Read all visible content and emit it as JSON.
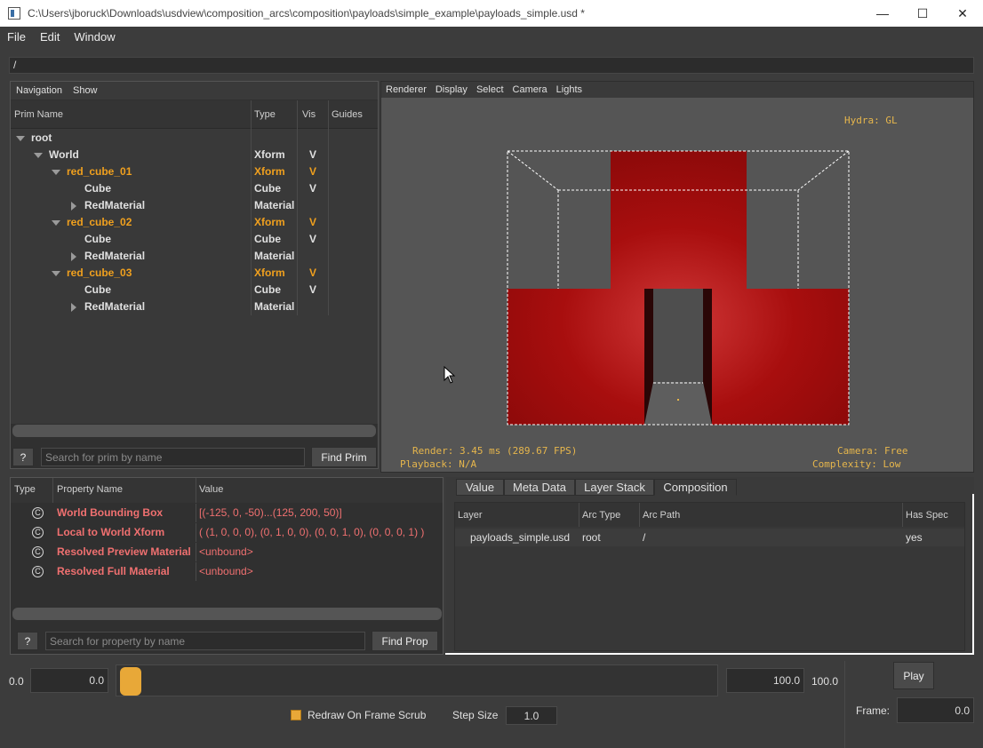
{
  "window": {
    "title": "C:\\Users\\jboruck\\Downloads\\usdview\\composition_arcs\\composition\\payloads\\simple_example\\payloads_simple.usd *",
    "minimize": "—",
    "maximize": "☐",
    "close": "✕"
  },
  "menu": [
    "File",
    "Edit",
    "Window"
  ],
  "path": "/",
  "nav": {
    "menu": [
      "Navigation",
      "Show"
    ],
    "columns": [
      "Prim Name",
      "Type",
      "Vis",
      "Guides"
    ],
    "rows": [
      {
        "name": "root",
        "type": "",
        "vis": "",
        "orange": false,
        "depth": 0,
        "arrow": "down"
      },
      {
        "name": "World",
        "type": "Xform",
        "vis": "V",
        "orange": false,
        "depth": 1,
        "arrow": "down"
      },
      {
        "name": "red_cube_01",
        "type": "Xform",
        "vis": "V",
        "orange": true,
        "depth": 2,
        "arrow": "down"
      },
      {
        "name": "Cube",
        "type": "Cube",
        "vis": "V",
        "orange": false,
        "depth": 3,
        "arrow": ""
      },
      {
        "name": "RedMaterial",
        "type": "Material",
        "vis": "",
        "orange": false,
        "depth": 3,
        "arrow": "right"
      },
      {
        "name": "red_cube_02",
        "type": "Xform",
        "vis": "V",
        "orange": true,
        "depth": 2,
        "arrow": "down"
      },
      {
        "name": "Cube",
        "type": "Cube",
        "vis": "V",
        "orange": false,
        "depth": 3,
        "arrow": ""
      },
      {
        "name": "RedMaterial",
        "type": "Material",
        "vis": "",
        "orange": false,
        "depth": 3,
        "arrow": "right"
      },
      {
        "name": "red_cube_03",
        "type": "Xform",
        "vis": "V",
        "orange": true,
        "depth": 2,
        "arrow": "down"
      },
      {
        "name": "Cube",
        "type": "Cube",
        "vis": "V",
        "orange": false,
        "depth": 3,
        "arrow": ""
      },
      {
        "name": "RedMaterial",
        "type": "Material",
        "vis": "",
        "orange": false,
        "depth": 3,
        "arrow": "right"
      }
    ],
    "help_label": "?",
    "search_placeholder": "Search for prim by name",
    "find_label": "Find Prim"
  },
  "viewport": {
    "menu": [
      "Renderer",
      "Display",
      "Select",
      "Camera",
      "Lights"
    ],
    "hud_renderer": "Hydra: GL",
    "hud_render": "Render: 3.45 ms (289.67 FPS)",
    "hud_playback": "Playback: N/A",
    "hud_camera": "Camera: Free",
    "hud_complexity": "Complexity: Low"
  },
  "props": {
    "columns": [
      "Type",
      "Property Name",
      "Value"
    ],
    "rows": [
      {
        "icon": "C",
        "name": "World Bounding Box",
        "value": "[(-125, 0, -50)...(125, 200, 50)]"
      },
      {
        "icon": "C",
        "name": "Local to World Xform",
        "value": "( (1, 0, 0, 0), (0, 1, 0, 0), (0, 0, 1, 0), (0, 0, 0, 1) )"
      },
      {
        "icon": "C",
        "name": "Resolved Preview Material",
        "value": "<unbound>"
      },
      {
        "icon": "C",
        "name": "Resolved Full Material",
        "value": "<unbound>"
      }
    ],
    "help_label": "?",
    "search_placeholder": "Search for property by name",
    "find_label": "Find Prop"
  },
  "composition": {
    "tabs": [
      "Value",
      "Meta Data",
      "Layer Stack",
      "Composition"
    ],
    "active_tab": "Composition",
    "columns": [
      "Layer",
      "Arc Type",
      "Arc Path",
      "Has Spec"
    ],
    "row": {
      "layer": "payloads_simple.usd",
      "arc_type": "root",
      "arc_path": "/",
      "has_spec": "yes"
    }
  },
  "timeline": {
    "start_label": "0.0",
    "start_value": "0.0",
    "end_value": "100.0",
    "end_label": "100.0",
    "play_label": "Play",
    "redraw_label": "Redraw On Frame Scrub",
    "step_label": "Step Size",
    "step_value": "1.0",
    "frame_label": "Frame:",
    "frame_value": "0.0"
  },
  "colors": {
    "accent": "#f0a01e",
    "prop_text": "#f07070",
    "cube_red": "#b01010"
  }
}
